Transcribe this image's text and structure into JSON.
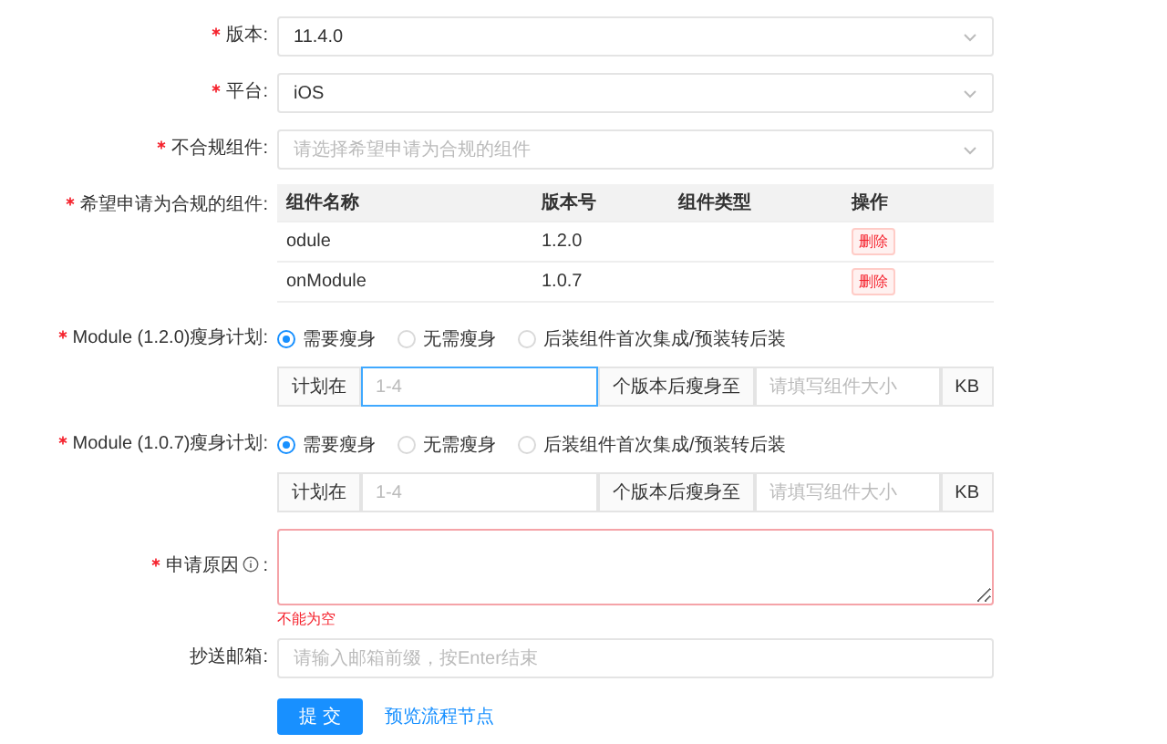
{
  "selects": [
    {
      "label": "版本:",
      "required": true,
      "value": "11.4.0"
    },
    {
      "label": "平台:",
      "required": true,
      "value": "iOS"
    },
    {
      "label": "不合规组件:",
      "required": true,
      "placeholder": "请选择希望申请为合规的组件"
    }
  ],
  "components": {
    "label": "希望申请为合规的组件:",
    "required": true,
    "columns": [
      "组件名称",
      "版本号",
      "组件类型",
      "操作"
    ],
    "rows": [
      {
        "name": "odule",
        "version": "1.2.0",
        "action": "删除"
      },
      {
        "name": "onModule",
        "version": "1.0.7",
        "action": "删除"
      }
    ]
  },
  "plans": [
    {
      "label": "Module (1.2.0)瘦身计划:",
      "required": true,
      "options": [
        {
          "label": "需要瘦身",
          "selected": true
        },
        {
          "label": "无需瘦身",
          "selected": false
        },
        {
          "label": "后装组件首次集成/预装转后装",
          "selected": false
        }
      ],
      "prefix": "计划在",
      "placeholder": "1-4",
      "focused": true,
      "middle": "个版本后瘦身至",
      "size_placeholder": "请填写组件大小",
      "suffix": "KB"
    },
    {
      "label": "Module (1.0.7)瘦身计划:",
      "required": true,
      "options": [
        {
          "label": "需要瘦身",
          "selected": true
        },
        {
          "label": "无需瘦身",
          "selected": false
        },
        {
          "label": "后装组件首次集成/预装转后装",
          "selected": false
        }
      ],
      "prefix": "计划在",
      "placeholder": "1-4",
      "focused": false,
      "middle": "个版本后瘦身至",
      "size_placeholder": "请填写组件大小",
      "suffix": "KB"
    }
  ],
  "reason": {
    "label": "申请原因",
    "colon": ":",
    "required": true,
    "error": "不能为空"
  },
  "cc": {
    "label": "抄送邮箱:",
    "required": false,
    "placeholder": "请输入邮箱前缀，按Enter结束"
  },
  "submit": "提 交",
  "preview_link": "预览流程节点"
}
